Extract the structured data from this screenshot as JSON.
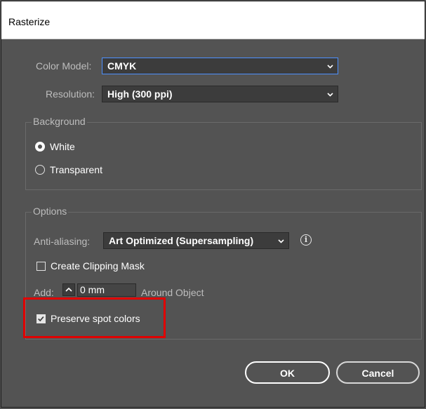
{
  "window": {
    "title": "Rasterize"
  },
  "color_model": {
    "label": "Color Model:",
    "value": "CMYK"
  },
  "resolution": {
    "label": "Resolution:",
    "value": "High (300 ppi)"
  },
  "background_group": {
    "legend": "Background",
    "options": [
      {
        "label": "White",
        "selected": true
      },
      {
        "label": "Transparent",
        "selected": false
      }
    ]
  },
  "options_group": {
    "legend": "Options",
    "anti_aliasing": {
      "label": "Anti-aliasing:",
      "value": "Art Optimized (Supersampling)",
      "info_icon": "i"
    },
    "clipping_mask": {
      "label": "Create Clipping Mask",
      "checked": false
    },
    "add": {
      "label": "Add:",
      "value": "0 mm",
      "suffix": "Around Object"
    },
    "preserve_spot": {
      "label": "Preserve spot colors",
      "checked": true
    }
  },
  "buttons": {
    "ok": "OK",
    "cancel": "Cancel"
  },
  "annotation": {
    "highlight_color": "#e00000"
  },
  "colors": {
    "dialog_bg": "#535353",
    "field_bg": "#3c3c3c",
    "focus_border": "#4d90ff"
  }
}
